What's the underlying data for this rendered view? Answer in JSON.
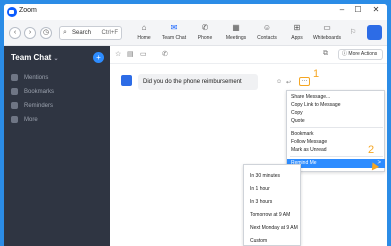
{
  "titlebar": {
    "app_title": "Zoom",
    "minimize": "–",
    "maximize": "☐",
    "close": "✕"
  },
  "toolbar": {
    "search_label": "Search",
    "search_shortcut": "Ctrl+F",
    "nav": [
      {
        "label": "Home",
        "icon": "⌂",
        "icon_name": "home-icon"
      },
      {
        "label": "Team Chat",
        "icon": "✉",
        "icon_name": "chat-icon"
      },
      {
        "label": "Phone",
        "icon": "✆",
        "icon_name": "phone-icon"
      },
      {
        "label": "Meetings",
        "icon": "▦",
        "icon_name": "meetings-icon"
      },
      {
        "label": "Contacts",
        "icon": "☺",
        "icon_name": "contacts-icon"
      },
      {
        "label": "Apps",
        "icon": "⊞",
        "icon_name": "apps-icon"
      },
      {
        "label": "Whiteboards",
        "icon": "▭",
        "icon_name": "whiteboards-icon"
      }
    ]
  },
  "sidebar": {
    "title": "Team Chat",
    "title_chevron": "⌄",
    "items": [
      {
        "label": "Mentions"
      },
      {
        "label": "Bookmarks"
      },
      {
        "label": "Reminders"
      },
      {
        "label": "More"
      }
    ]
  },
  "main": {
    "more_actions_label": "More Actions",
    "message_text": "Did you do the phone reimbursement",
    "more_button": "···",
    "step1": "1",
    "step2": "2"
  },
  "context_menu": {
    "items": [
      "Share Message...",
      "Copy Link to Message",
      "Copy",
      "Quote",
      "Bookmark",
      "Follow Message",
      "Mark as Unread",
      "Remind Me"
    ],
    "remind_arrow": ">"
  },
  "remind_submenu": {
    "items": [
      "In 30 minutes",
      "In 1 hour",
      "In 3 hours",
      "Tomorrow at 9 AM",
      "Next Monday at 9 AM",
      "Custom"
    ]
  },
  "colors": {
    "accent": "#0b5cff",
    "highlight": "#2d8cff",
    "annotation": "#f5a623",
    "sidebar": "#2f3542",
    "background": "#2b8ce6"
  }
}
